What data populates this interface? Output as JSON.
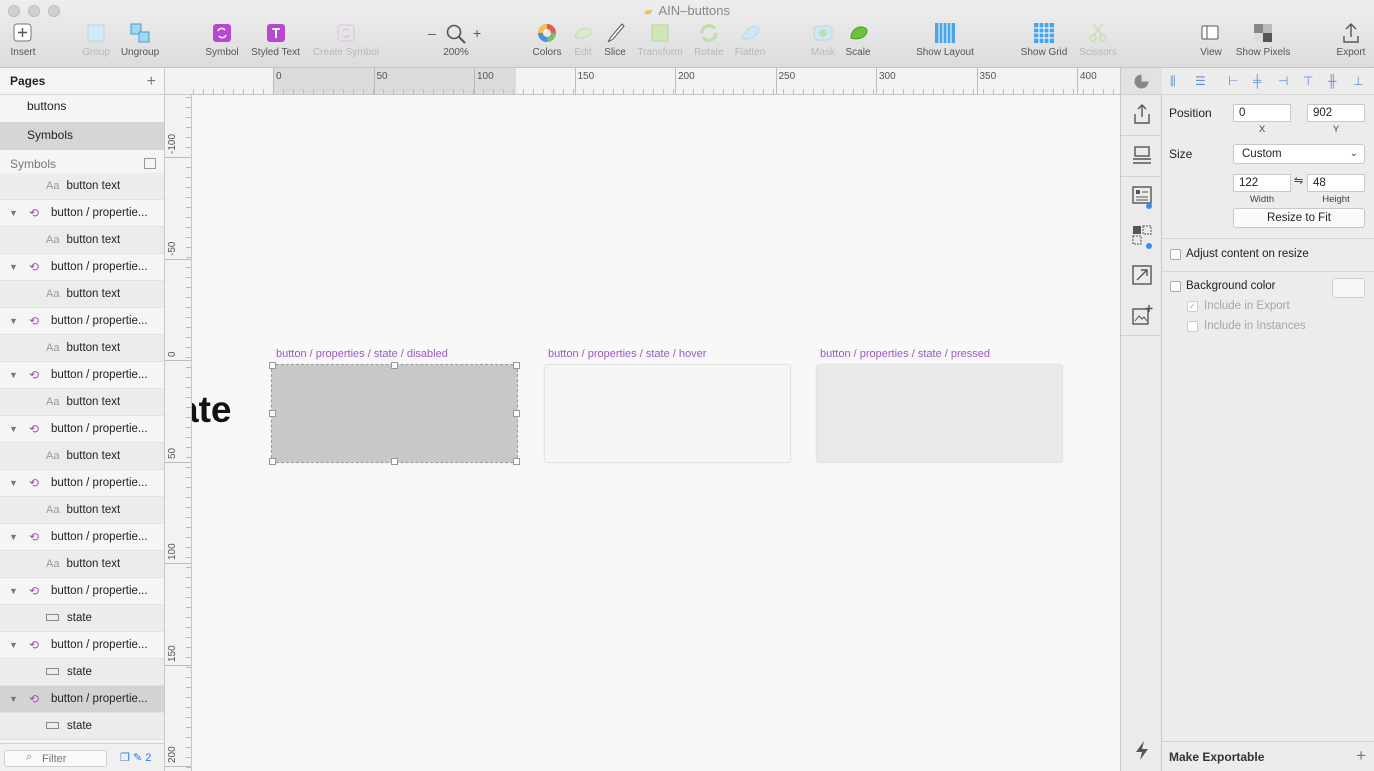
{
  "window": {
    "title": "AIN–buttons"
  },
  "toolbar": {
    "insert": "Insert",
    "group": "Group",
    "ungroup": "Ungroup",
    "symbol": "Symbol",
    "styled_text": "Styled Text",
    "create_symbol": "Create Symbol",
    "zoom_minus": "–",
    "zoom_plus": "+",
    "zoom": "200%",
    "colors": "Colors",
    "edit": "Edit",
    "slice": "Slice",
    "transform": "Transform",
    "rotate": "Rotate",
    "flatten": "Flatten",
    "mask": "Mask",
    "scale": "Scale",
    "show_layout": "Show Layout",
    "show_grid": "Show Grid",
    "scissors": "Scissors",
    "view": "View",
    "show_pixels": "Show Pixels",
    "export": "Export"
  },
  "left_panel": {
    "pages_header": "Pages",
    "pages": [
      {
        "label": "buttons",
        "selected": false
      },
      {
        "label": "Symbols",
        "selected": true
      }
    ],
    "layers_header": "Symbols",
    "layers": [
      {
        "type": "text",
        "label": "button text"
      },
      {
        "type": "symbol",
        "label": "button / propertie..."
      },
      {
        "type": "text",
        "label": "button text"
      },
      {
        "type": "symbol",
        "label": "button / propertie..."
      },
      {
        "type": "text",
        "label": "button text"
      },
      {
        "type": "symbol",
        "label": "button / propertie..."
      },
      {
        "type": "text",
        "label": "button text"
      },
      {
        "type": "symbol",
        "label": "button / propertie..."
      },
      {
        "type": "text",
        "label": "button text"
      },
      {
        "type": "symbol",
        "label": "button / propertie..."
      },
      {
        "type": "text",
        "label": "button text"
      },
      {
        "type": "symbol",
        "label": "button / propertie..."
      },
      {
        "type": "text",
        "label": "button text"
      },
      {
        "type": "symbol",
        "label": "button / propertie..."
      },
      {
        "type": "text",
        "label": "button text"
      },
      {
        "type": "symbol",
        "label": "button / propertie..."
      },
      {
        "type": "rect",
        "label": "state"
      },
      {
        "type": "symbol",
        "label": "button / propertie..."
      },
      {
        "type": "rect",
        "label": "state"
      },
      {
        "type": "symbol",
        "label": "button / propertie...",
        "selected": true
      },
      {
        "type": "rect",
        "label": "state"
      }
    ],
    "filter_placeholder": "Filter",
    "filter_count": "2"
  },
  "rulers": {
    "top": [
      "0",
      "50",
      "100",
      "150",
      "200",
      "250",
      "300",
      "350",
      "400"
    ],
    "left": [
      "-100",
      "-50",
      "0",
      "50",
      "100",
      "150",
      "200"
    ]
  },
  "canvas": {
    "partial_text": "ate",
    "artboards": [
      {
        "label": "button / properties / state / disabled",
        "fill": "#c8c8c8",
        "selected": true
      },
      {
        "label": "button / properties / state / hover",
        "fill": "#f5f5f5",
        "selected": false
      },
      {
        "label": "button / properties / state / pressed",
        "fill": "#e9e9e9",
        "selected": false
      }
    ]
  },
  "inspector": {
    "position_label": "Position",
    "x_value": "0",
    "x_caption": "X",
    "y_value": "902",
    "y_caption": "Y",
    "size_label": "Size",
    "size_preset": "Custom",
    "width_value": "122",
    "width_caption": "Width",
    "height_value": "48",
    "height_caption": "Height",
    "lock_icon": "⇋",
    "resize_to_fit": "Resize to Fit",
    "adjust_content": "Adjust content on resize",
    "background_color": "Background color",
    "include_export": "Include in Export",
    "include_instances": "Include in Instances",
    "make_exportable": "Make Exportable",
    "make_exportable_plus": "+"
  }
}
